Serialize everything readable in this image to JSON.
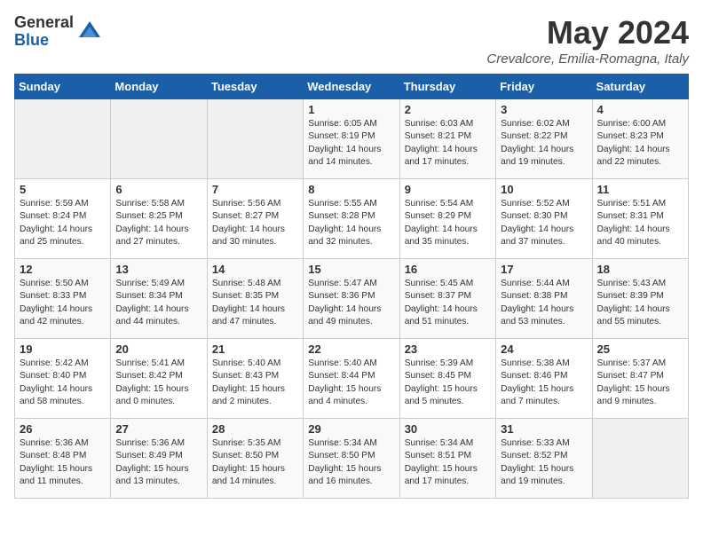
{
  "logo": {
    "general": "General",
    "blue": "Blue"
  },
  "title": "May 2024",
  "location": "Crevalcore, Emilia-Romagna, Italy",
  "days_header": [
    "Sunday",
    "Monday",
    "Tuesday",
    "Wednesday",
    "Thursday",
    "Friday",
    "Saturday"
  ],
  "weeks": [
    [
      {
        "day": "",
        "content": ""
      },
      {
        "day": "",
        "content": ""
      },
      {
        "day": "",
        "content": ""
      },
      {
        "day": "1",
        "content": "Sunrise: 6:05 AM\nSunset: 8:19 PM\nDaylight: 14 hours\nand 14 minutes."
      },
      {
        "day": "2",
        "content": "Sunrise: 6:03 AM\nSunset: 8:21 PM\nDaylight: 14 hours\nand 17 minutes."
      },
      {
        "day": "3",
        "content": "Sunrise: 6:02 AM\nSunset: 8:22 PM\nDaylight: 14 hours\nand 19 minutes."
      },
      {
        "day": "4",
        "content": "Sunrise: 6:00 AM\nSunset: 8:23 PM\nDaylight: 14 hours\nand 22 minutes."
      }
    ],
    [
      {
        "day": "5",
        "content": "Sunrise: 5:59 AM\nSunset: 8:24 PM\nDaylight: 14 hours\nand 25 minutes."
      },
      {
        "day": "6",
        "content": "Sunrise: 5:58 AM\nSunset: 8:25 PM\nDaylight: 14 hours\nand 27 minutes."
      },
      {
        "day": "7",
        "content": "Sunrise: 5:56 AM\nSunset: 8:27 PM\nDaylight: 14 hours\nand 30 minutes."
      },
      {
        "day": "8",
        "content": "Sunrise: 5:55 AM\nSunset: 8:28 PM\nDaylight: 14 hours\nand 32 minutes."
      },
      {
        "day": "9",
        "content": "Sunrise: 5:54 AM\nSunset: 8:29 PM\nDaylight: 14 hours\nand 35 minutes."
      },
      {
        "day": "10",
        "content": "Sunrise: 5:52 AM\nSunset: 8:30 PM\nDaylight: 14 hours\nand 37 minutes."
      },
      {
        "day": "11",
        "content": "Sunrise: 5:51 AM\nSunset: 8:31 PM\nDaylight: 14 hours\nand 40 minutes."
      }
    ],
    [
      {
        "day": "12",
        "content": "Sunrise: 5:50 AM\nSunset: 8:33 PM\nDaylight: 14 hours\nand 42 minutes."
      },
      {
        "day": "13",
        "content": "Sunrise: 5:49 AM\nSunset: 8:34 PM\nDaylight: 14 hours\nand 44 minutes."
      },
      {
        "day": "14",
        "content": "Sunrise: 5:48 AM\nSunset: 8:35 PM\nDaylight: 14 hours\nand 47 minutes."
      },
      {
        "day": "15",
        "content": "Sunrise: 5:47 AM\nSunset: 8:36 PM\nDaylight: 14 hours\nand 49 minutes."
      },
      {
        "day": "16",
        "content": "Sunrise: 5:45 AM\nSunset: 8:37 PM\nDaylight: 14 hours\nand 51 minutes."
      },
      {
        "day": "17",
        "content": "Sunrise: 5:44 AM\nSunset: 8:38 PM\nDaylight: 14 hours\nand 53 minutes."
      },
      {
        "day": "18",
        "content": "Sunrise: 5:43 AM\nSunset: 8:39 PM\nDaylight: 14 hours\nand 55 minutes."
      }
    ],
    [
      {
        "day": "19",
        "content": "Sunrise: 5:42 AM\nSunset: 8:40 PM\nDaylight: 14 hours\nand 58 minutes."
      },
      {
        "day": "20",
        "content": "Sunrise: 5:41 AM\nSunset: 8:42 PM\nDaylight: 15 hours\nand 0 minutes."
      },
      {
        "day": "21",
        "content": "Sunrise: 5:40 AM\nSunset: 8:43 PM\nDaylight: 15 hours\nand 2 minutes."
      },
      {
        "day": "22",
        "content": "Sunrise: 5:40 AM\nSunset: 8:44 PM\nDaylight: 15 hours\nand 4 minutes."
      },
      {
        "day": "23",
        "content": "Sunrise: 5:39 AM\nSunset: 8:45 PM\nDaylight: 15 hours\nand 5 minutes."
      },
      {
        "day": "24",
        "content": "Sunrise: 5:38 AM\nSunset: 8:46 PM\nDaylight: 15 hours\nand 7 minutes."
      },
      {
        "day": "25",
        "content": "Sunrise: 5:37 AM\nSunset: 8:47 PM\nDaylight: 15 hours\nand 9 minutes."
      }
    ],
    [
      {
        "day": "26",
        "content": "Sunrise: 5:36 AM\nSunset: 8:48 PM\nDaylight: 15 hours\nand 11 minutes."
      },
      {
        "day": "27",
        "content": "Sunrise: 5:36 AM\nSunset: 8:49 PM\nDaylight: 15 hours\nand 13 minutes."
      },
      {
        "day": "28",
        "content": "Sunrise: 5:35 AM\nSunset: 8:50 PM\nDaylight: 15 hours\nand 14 minutes."
      },
      {
        "day": "29",
        "content": "Sunrise: 5:34 AM\nSunset: 8:50 PM\nDaylight: 15 hours\nand 16 minutes."
      },
      {
        "day": "30",
        "content": "Sunrise: 5:34 AM\nSunset: 8:51 PM\nDaylight: 15 hours\nand 17 minutes."
      },
      {
        "day": "31",
        "content": "Sunrise: 5:33 AM\nSunset: 8:52 PM\nDaylight: 15 hours\nand 19 minutes."
      },
      {
        "day": "",
        "content": ""
      }
    ]
  ]
}
